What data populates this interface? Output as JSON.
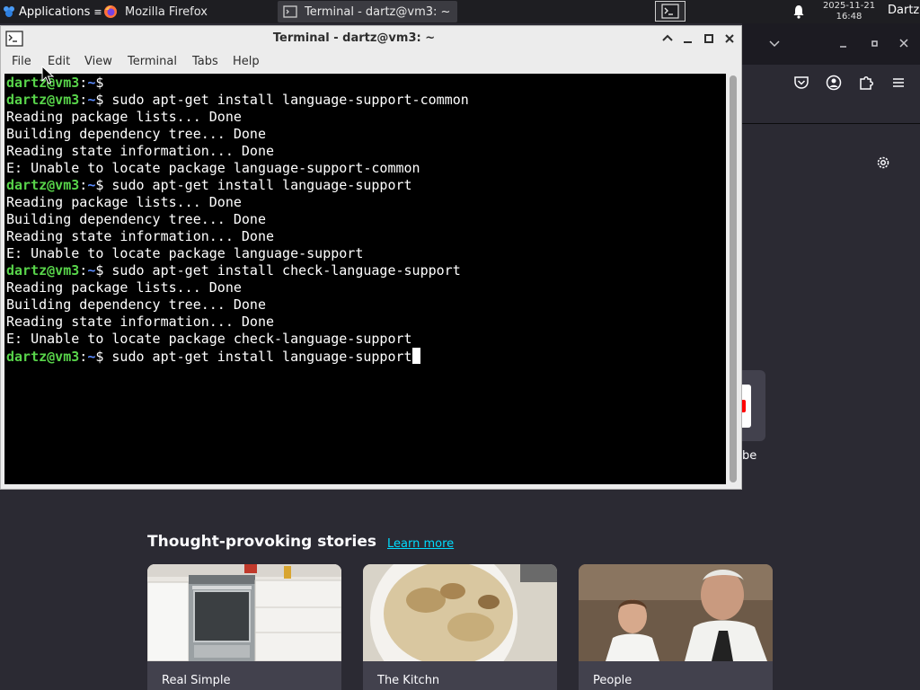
{
  "panel": {
    "applications_label": "Applications",
    "firefox_task_label": "Mozilla Firefox",
    "terminal_task_label": "Terminal - dartz@vm3: ~",
    "clock_date": "2025-11-21",
    "clock_time": "16:48",
    "username": "Dartz"
  },
  "terminal": {
    "title": "Terminal - dartz@vm3: ~",
    "menu": [
      "File",
      "Edit",
      "View",
      "Terminal",
      "Tabs",
      "Help"
    ],
    "prompt_user": "dartz@vm3",
    "prompt_path": "~",
    "lines": [
      {
        "type": "prompt",
        "cmd": ""
      },
      {
        "type": "prompt",
        "cmd": "sudo apt-get install language-support-common"
      },
      {
        "type": "out",
        "text": "Reading package lists... Done"
      },
      {
        "type": "out",
        "text": "Building dependency tree... Done"
      },
      {
        "type": "out",
        "text": "Reading state information... Done"
      },
      {
        "type": "out",
        "text": "E: Unable to locate package language-support-common"
      },
      {
        "type": "prompt",
        "cmd": "sudo apt-get install language-support"
      },
      {
        "type": "out",
        "text": "Reading package lists... Done"
      },
      {
        "type": "out",
        "text": "Building dependency tree... Done"
      },
      {
        "type": "out",
        "text": "Reading state information... Done"
      },
      {
        "type": "out",
        "text": "E: Unable to locate package language-support"
      },
      {
        "type": "prompt",
        "cmd": "sudo apt-get install check-language-support"
      },
      {
        "type": "out",
        "text": "Reading package lists... Done"
      },
      {
        "type": "out",
        "text": "Building dependency tree... Done"
      },
      {
        "type": "out",
        "text": "Reading state information... Done"
      },
      {
        "type": "out",
        "text": "E: Unable to locate package check-language-support"
      },
      {
        "type": "prompt",
        "cmd": "sudo apt-get install language-support",
        "cursor": true
      }
    ]
  },
  "firefox": {
    "shortcut_label": "be",
    "stories": {
      "heading": "Thought-provoking stories",
      "learn_more": "Learn more",
      "cards": [
        {
          "source": "Real Simple"
        },
        {
          "source": "The Kitchn"
        },
        {
          "source": "People"
        }
      ]
    }
  },
  "colors": {
    "prompt_user": "#58d44a",
    "prompt_path": "#5b8cff",
    "terminal_bg": "#000000",
    "firefox_bg": "#2b2a33",
    "link": "#00ddff"
  }
}
